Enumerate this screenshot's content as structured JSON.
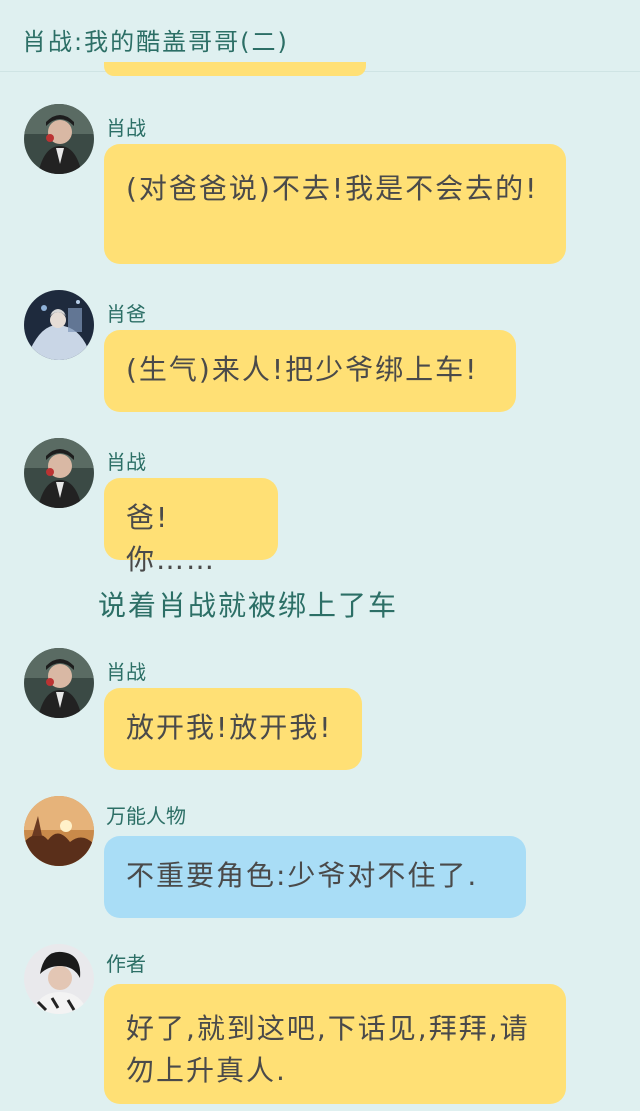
{
  "header": {
    "title": "肖战:我的酷盖哥哥(二)"
  },
  "messages": [
    {
      "name": "肖战",
      "text": "(对爸爸说)不去!我是不会去的!",
      "avatar_icon": "avatar-xiao-zhan-icon",
      "bubble_color": "#ffe075"
    },
    {
      "name": "肖爸",
      "text": "(生气)来人!把少爷绑上车!",
      "avatar_icon": "avatar-xiao-ba-icon",
      "bubble_color": "#ffe075"
    },
    {
      "name": "肖战",
      "text": "爸!你……",
      "avatar_icon": "avatar-xiao-zhan-icon",
      "bubble_color": "#ffe075"
    },
    {
      "name": "肖战",
      "text": "放开我!放开我!",
      "avatar_icon": "avatar-xiao-zhan-icon",
      "bubble_color": "#ffe075"
    },
    {
      "name": "万能人物",
      "text": "不重要角色:少爷对不住了.",
      "avatar_icon": "avatar-sunset-icon",
      "bubble_color": "#a9ddf6"
    },
    {
      "name": "作者",
      "text": "好了,就到这吧,下话见,拜拜,请勿上升真人.",
      "avatar_icon": "avatar-author-icon",
      "bubble_color": "#ffe075"
    }
  ],
  "narration": "说着肖战就被绑上了车"
}
